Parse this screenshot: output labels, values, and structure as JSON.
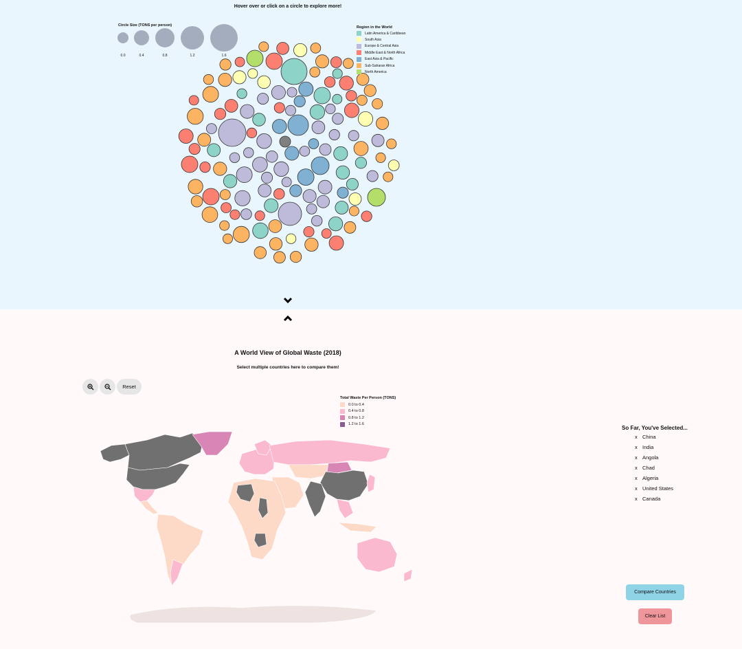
{
  "bubble_section": {
    "hint": "Hover over or click on a circle to explore more!",
    "size_legend": {
      "title": "Circle Size (TONS per person)",
      "labels": [
        "0.0",
        "0.4",
        "0.8",
        "1.2",
        "1.6"
      ]
    },
    "region_legend": {
      "title": "Region in the World",
      "items": [
        {
          "label": "Latin America & Caribbean",
          "color": "#8dd3c7"
        },
        {
          "label": "South Asia",
          "color": "#ffffb3"
        },
        {
          "label": "Europe & Central Asia",
          "color": "#bebada"
        },
        {
          "label": "Middle East & North Africa",
          "color": "#fb8072"
        },
        {
          "label": "East Asia & Pacific",
          "color": "#80b1d3"
        },
        {
          "label": "Sub-Saharan Africa",
          "color": "#fdb462"
        },
        {
          "label": "North America",
          "color": "#b3de69"
        }
      ]
    },
    "unknown_color": "#808080",
    "bubble_stroke": "#333333",
    "size_legend_color": "#a3adbe"
  },
  "scroll": {
    "down_icon": "chevron-down-icon",
    "up_icon": "chevron-up-icon"
  },
  "map_section": {
    "title": "A World View of Global Waste (2018)",
    "subtitle": "Select multiple countries here to compare them!",
    "zoom_in_icon": "zoom-in-icon",
    "zoom_out_icon": "zoom-out-icon",
    "reset_label": "Reset",
    "legend": {
      "title": "Total Waste Per Person (TONS)",
      "items": [
        {
          "label": "0.0 to 0.4",
          "color": "#fdd9c8"
        },
        {
          "label": "0.4 to 0.8",
          "color": "#fbb9d0"
        },
        {
          "label": "0.8 to 1.2",
          "color": "#d886b6"
        },
        {
          "label": "1.2 to 1.6",
          "color": "#8a5c91"
        }
      ]
    },
    "selected_color": "#707070"
  },
  "selection_panel": {
    "title": "So Far, You've Selected...",
    "remove_glyph": "x",
    "countries": [
      "China",
      "India",
      "Angola",
      "Chad",
      "Algeria",
      "United States",
      "Canada"
    ],
    "compare_label": "Compare Countries",
    "clear_label": "Clear List"
  }
}
